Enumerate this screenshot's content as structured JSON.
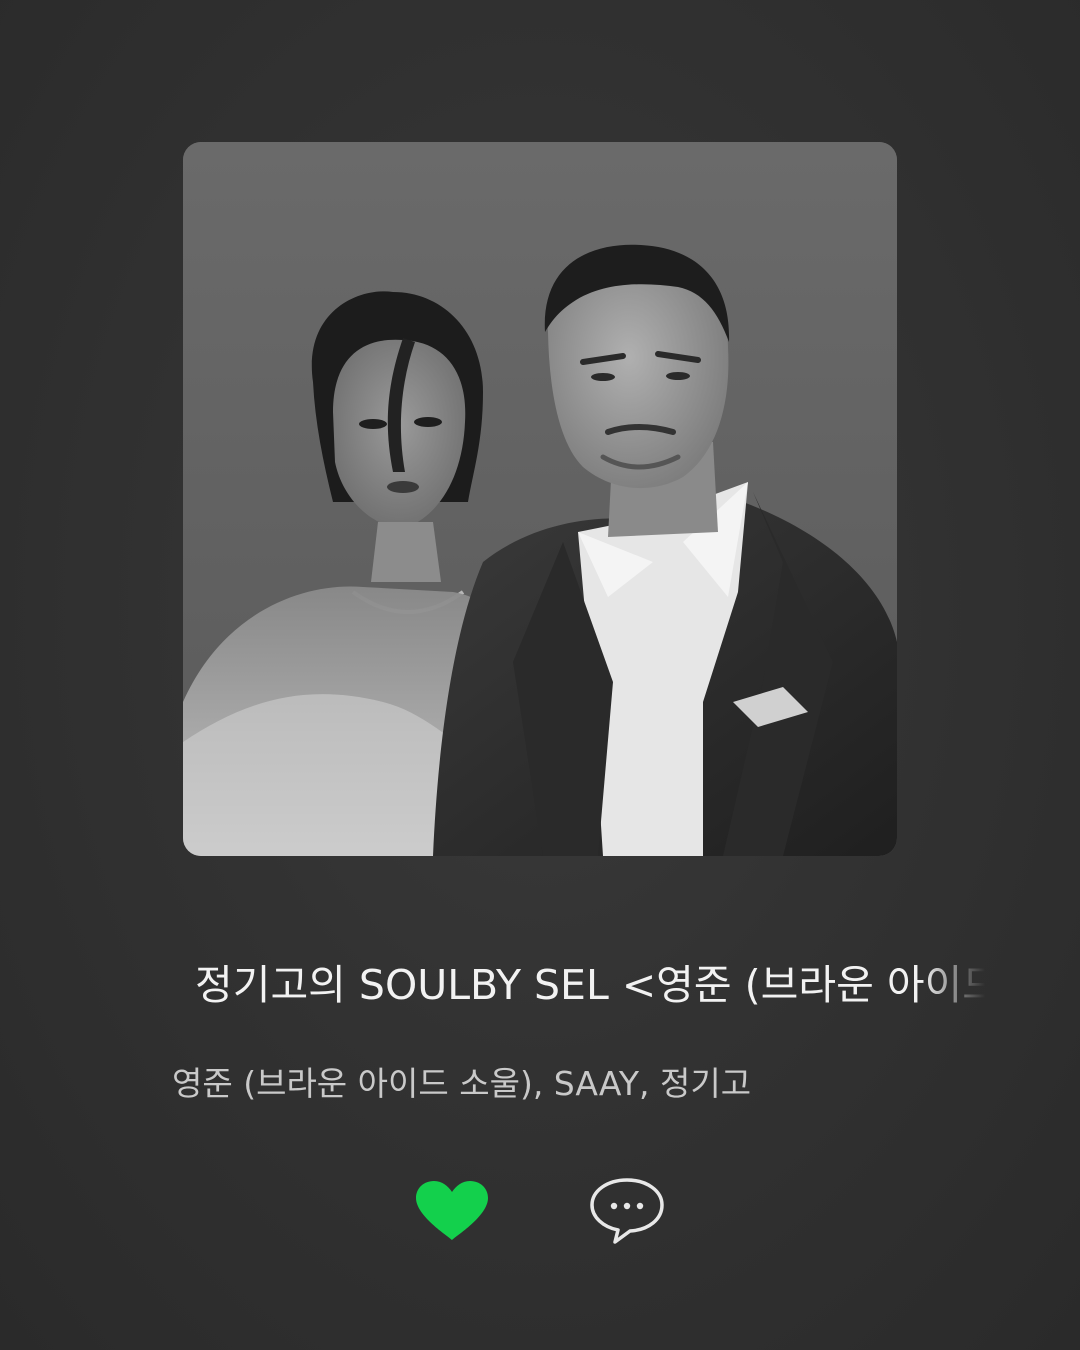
{
  "song": {
    "title": "정기고의 SOULBY SEL <영준 (브라운 아이드 소울), SAAY, 정기고>",
    "artists": "영준 (브라운 아이드 소울), SAAY, 정기고"
  },
  "actions": {
    "liked": true,
    "like_icon": "heart-icon",
    "comment_icon": "speech-bubble-icon"
  },
  "colors": {
    "accent": "#13d04c",
    "background": "#323232",
    "title_text": "#f2f2f2",
    "artist_text": "#c9c9c9"
  }
}
